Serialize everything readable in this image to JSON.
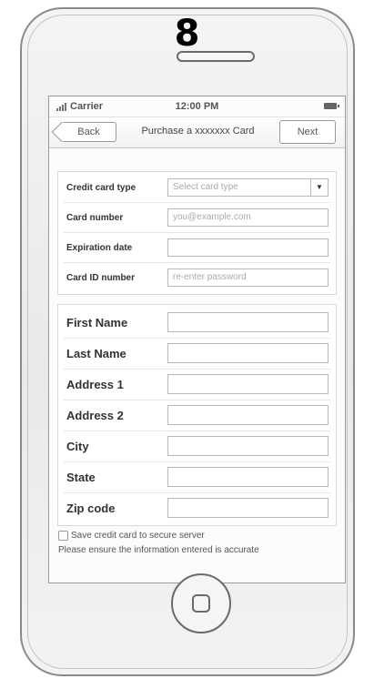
{
  "page_number": "8",
  "status_bar": {
    "carrier": "Carrier",
    "time": "12:00 PM"
  },
  "nav": {
    "back_label": "Back",
    "title": "Purchase a xxxxxxx Card",
    "next_label": "Next"
  },
  "card_form": {
    "card_type_label": "Credit card type",
    "card_type_placeholder": "Select card type",
    "card_number_label": "Card number",
    "card_number_placeholder": "you@example.com",
    "expiration_label": "Expiration date",
    "expiration_value": "",
    "card_id_label": "Card ID number",
    "card_id_placeholder": "re-enter password"
  },
  "address_form": {
    "first_name_label": "First Name",
    "last_name_label": "Last Name",
    "address1_label": "Address 1",
    "address2_label": "Address 2",
    "city_label": "City",
    "state_label": "State",
    "zip_label": "Zip code"
  },
  "save_card_label": "Save credit card to secure server",
  "note": "Please ensure the information entered is accurate",
  "icons": [
    "signal-icon",
    "battery-icon",
    "back-arrow-icon",
    "dropdown-arrow-icon",
    "home-button-icon"
  ]
}
